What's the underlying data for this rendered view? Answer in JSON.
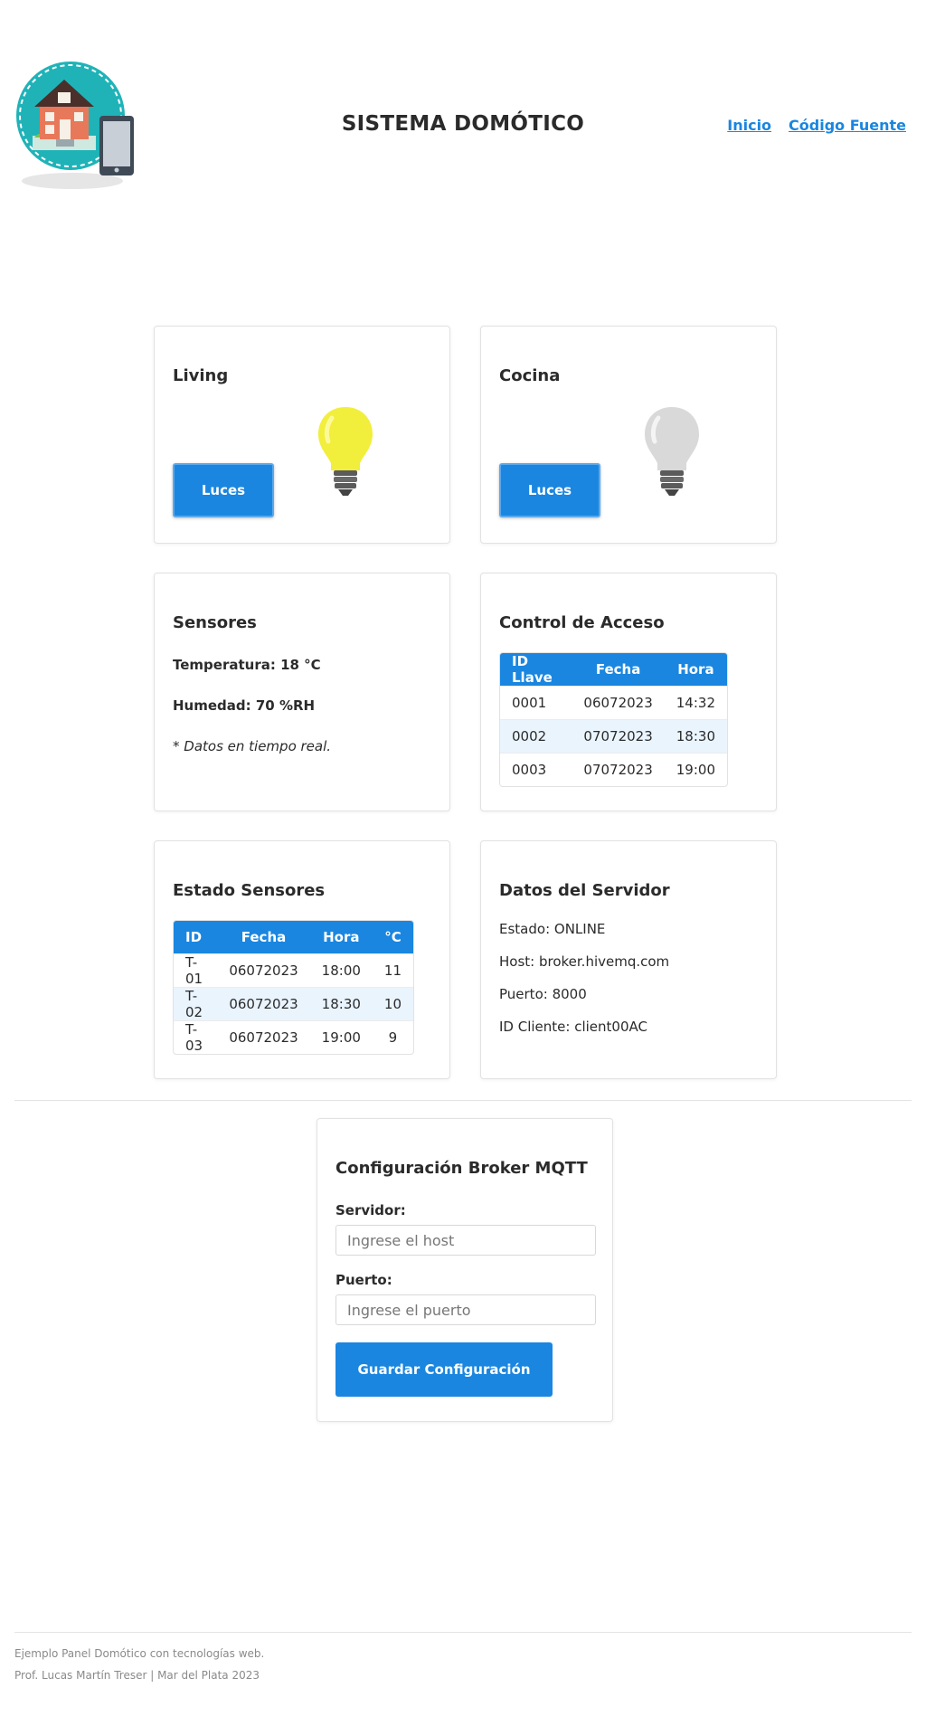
{
  "header": {
    "title": "SISTEMA DOMÓTICO",
    "nav": [
      {
        "label": "Inicio"
      },
      {
        "label": "Código Fuente"
      }
    ]
  },
  "rooms": [
    {
      "name": "Living",
      "button_label": "Luces",
      "light_on": true,
      "bulb_color": "#f2ee3c"
    },
    {
      "name": "Cocina",
      "button_label": "Luces",
      "light_on": false,
      "bulb_color": "#d9d9d9"
    }
  ],
  "sensores": {
    "title": "Sensores",
    "temperatura": "Temperatura: 18 °C",
    "humedad": "Humedad: 70 %RH",
    "note": "* Datos en tiempo real."
  },
  "control_acceso": {
    "title": "Control de Acceso",
    "headers": [
      "ID Llave",
      "Fecha",
      "Hora"
    ],
    "rows": [
      [
        "0001",
        "06072023",
        "14:32"
      ],
      [
        "0002",
        "07072023",
        "18:30"
      ],
      [
        "0003",
        "07072023",
        "19:00"
      ]
    ]
  },
  "estado_sensores": {
    "title": "Estado Sensores",
    "headers": [
      "ID",
      "Fecha",
      "Hora",
      "°C"
    ],
    "rows": [
      [
        "T-01",
        "06072023",
        "18:00",
        "11"
      ],
      [
        "T-02",
        "06072023",
        "18:30",
        "10"
      ],
      [
        "T-03",
        "06072023",
        "19:00",
        "9"
      ]
    ]
  },
  "servidor": {
    "title": "Datos del Servidor",
    "estado": "Estado: ONLINE",
    "host": "Host: broker.hivemq.com",
    "puerto": "Puerto: 8000",
    "cliente": "ID Cliente: client00AC"
  },
  "config": {
    "title": "Configuración Broker MQTT",
    "servidor_label": "Servidor:",
    "servidor_placeholder": "Ingrese el host",
    "puerto_label": "Puerto:",
    "puerto_placeholder": "Ingrese el puerto",
    "save_label": "Guardar Configuración"
  },
  "footer": {
    "line1": "Ejemplo Panel Domótico con tecnologías web.",
    "line2": "Prof. Lucas Martín Treser | Mar del Plata 2023"
  },
  "colors": {
    "accent": "#1a86e0",
    "row_alt": "#eaf4fd",
    "logo_circle": "#1fb3b8"
  },
  "icons": {
    "logo": "smart-home-logo-icon",
    "bulb": "light-bulb-icon"
  }
}
